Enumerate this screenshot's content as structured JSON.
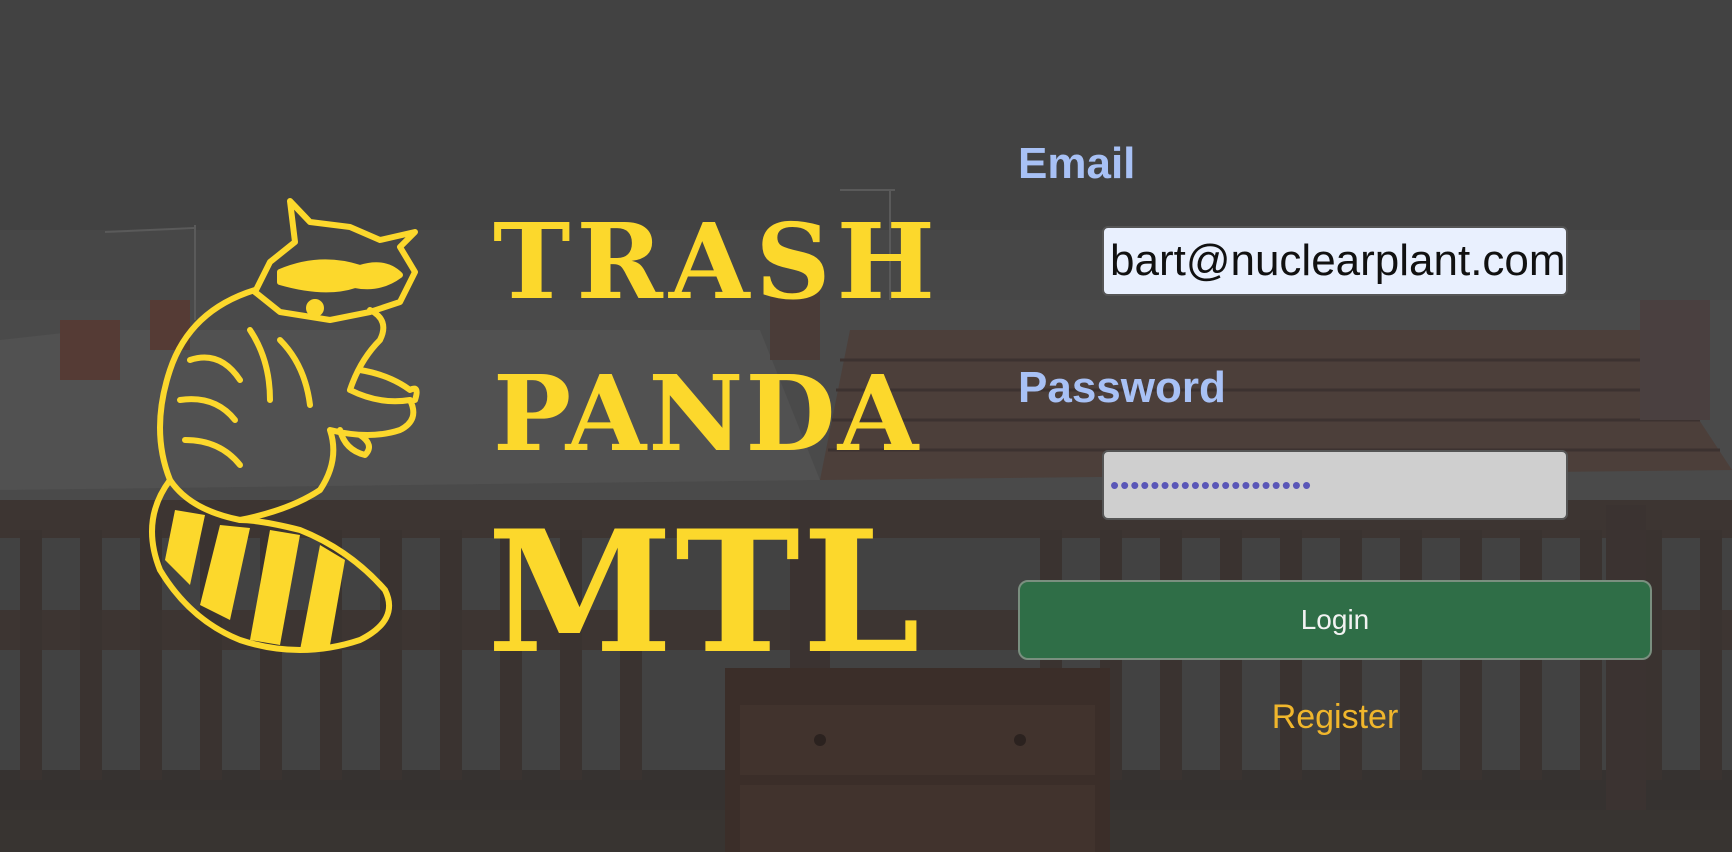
{
  "brand": {
    "line1": "TRASH",
    "line2": "PANDA",
    "line3": "MTL",
    "color": "#fcd82c"
  },
  "login_form": {
    "email_label": "Email",
    "email_value": "bart@nuclearplant.com",
    "password_label": "Password",
    "password_value": "••••••••••••••••••••",
    "login_label": "Login",
    "register_label": "Register"
  },
  "colors": {
    "label": "#a8c1f5",
    "login_button": "#2f6e47",
    "register_link": "#f0b62c",
    "overlay": "#3f3f3f"
  }
}
